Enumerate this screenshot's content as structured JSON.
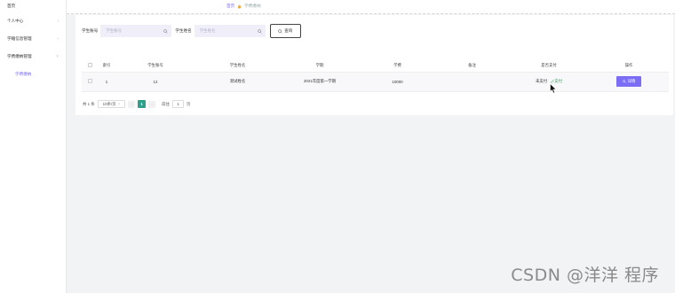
{
  "sidebar": {
    "items": [
      {
        "label": "首页",
        "has_children": false
      },
      {
        "label": "个人中心",
        "has_children": true
      },
      {
        "label": "学籍信息管理",
        "has_children": true
      },
      {
        "label": "学费缴纳管理",
        "has_children": true
      },
      {
        "label": "学费缴纳",
        "has_children": false
      }
    ]
  },
  "breadcrumb": {
    "home": "首页",
    "current": "学费缴纳"
  },
  "search": {
    "student_no_label": "学生账号",
    "student_no_placeholder": "学生账号",
    "student_name_label": "学生姓名",
    "student_name_placeholder": "学生姓名",
    "query_label": "查询"
  },
  "table": {
    "columns": [
      "索引",
      "学生账号",
      "学生姓名",
      "学期",
      "学费",
      "备注",
      "是否支付",
      "操作"
    ],
    "rows": [
      {
        "index": "1",
        "student_no": "12",
        "student_name": "测试姓名",
        "semester": "2021年度第一学期",
        "fee": "10000",
        "remark": "",
        "pay_status": "未支付",
        "pay_action": "支付",
        "action": "详情"
      }
    ]
  },
  "pager": {
    "total": "共 1 条",
    "page_size": "10条/页",
    "current_page": "1",
    "goto_prefix": "前往",
    "goto_value": "1",
    "goto_suffix": "页"
  },
  "watermark": "CSDN @洋洋 程序",
  "colors": {
    "accent": "#7b6ef5",
    "pager_active": "#2f9e8a",
    "pay_link": "#2f9e5a"
  }
}
